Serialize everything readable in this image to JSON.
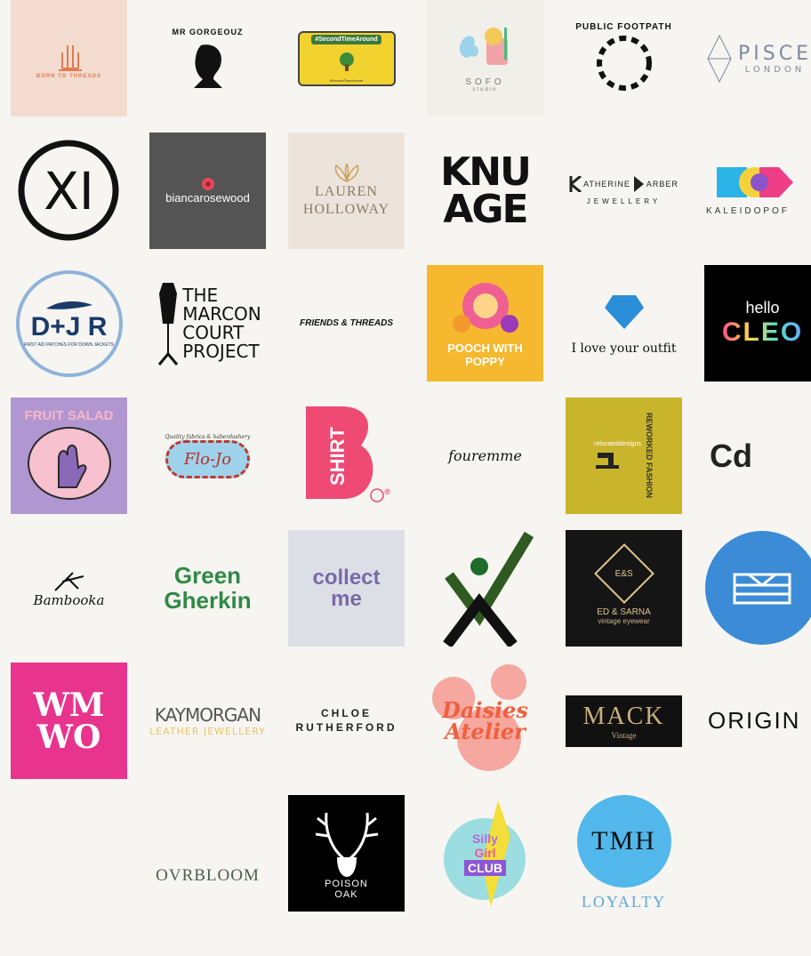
{
  "brands": {
    "born_to_threads": "BORN TO THREADS",
    "gorgeous": "MR GORGEOUZ",
    "second_time_around": "#SecondTimeAround",
    "second_time_small": "#SecondTimeAround",
    "sofo": "SOFO",
    "sofo_sub": "studio",
    "public_footpath": "PUBLIC FOOTPATH",
    "pisces": "PISCE",
    "pisces_sub": "LONDON",
    "xi": "XI",
    "bianca": "biancarosewood",
    "lauren_1": "LAUREN",
    "lauren_2": "HOLLOWAY",
    "knu_1": "KNU",
    "knu_2": "AGE",
    "katherine_1": "ATHERINE",
    "katherine_2": "ARBER",
    "katherine_sub": "JEWELLERY",
    "kaleidopop": "KALEIDOPOF",
    "djr": "D+J R",
    "djr_sub": "FIRST AID PATCHES FOR DOWN JACKETS",
    "marcon_1": "THE",
    "marcon_2": "MARCON",
    "marcon_3": "COURT",
    "marcon_4": "PROJECT",
    "friends_threads": "FRIENDS & THREADS",
    "poppy": "POOCH WITH POPPY",
    "i_love": "I love your outfit",
    "hello": "hello",
    "cleo": "CLEO",
    "fruit_salad": "FRUIT SALAD",
    "flojo_sub": "Quality fabrics & haberdashery",
    "flojo": "Flo-Jo",
    "shirt": "SHIRT",
    "shirt_mark": "®",
    "fouremme": "fouremme",
    "relocated": "relocateddesigns",
    "reworked": "REWORKED",
    "fashion": "FASHION",
    "cd": "Cd",
    "bambooka": "Bambooka",
    "green": "Green",
    "gherkin": "Gherkin",
    "collect": "collect",
    "me": "me",
    "ed_mono": "E&S",
    "ed_1": "ED & SARNA",
    "ed_2": "vintage eyewear",
    "wmwo_1": "WM",
    "wmwo_2": "WO",
    "kay_1": "KAYMORGAN",
    "kay_2": "LEATHER JEWELLERY",
    "chloe_1": "CHLOE",
    "chloe_2": "RUTHERFORD",
    "daisies_1": "Daisies",
    "daisies_2": "Atelier",
    "mack": "MACK",
    "mack_sub": "Vintage",
    "origin": "ORIGIN",
    "ovrbloom": "OVRBLOOM",
    "poison_1": "POISON",
    "poison_2": "OAK",
    "silly_1": "Silly",
    "silly_2": "Girl",
    "silly_3": "CLUB",
    "loyalty_mono": "TMH",
    "loyalty": "LOYALTY"
  },
  "colors": {
    "background": "#f6f5f1",
    "born_bg": "#f3dccf",
    "bianca_bg": "#545454",
    "poppy_bg": "#f5b82e",
    "hello_bg": "#000000",
    "fruit_bg": "#b197d1",
    "shirt_pink": "#ee4a74",
    "relocated_bg": "#c9b52c",
    "heart_blue": "#2a8ed9",
    "circle_blue": "#3b8bd6",
    "wmwo_bg": "#e8348c",
    "green_gherkin": "#2f8a45"
  }
}
